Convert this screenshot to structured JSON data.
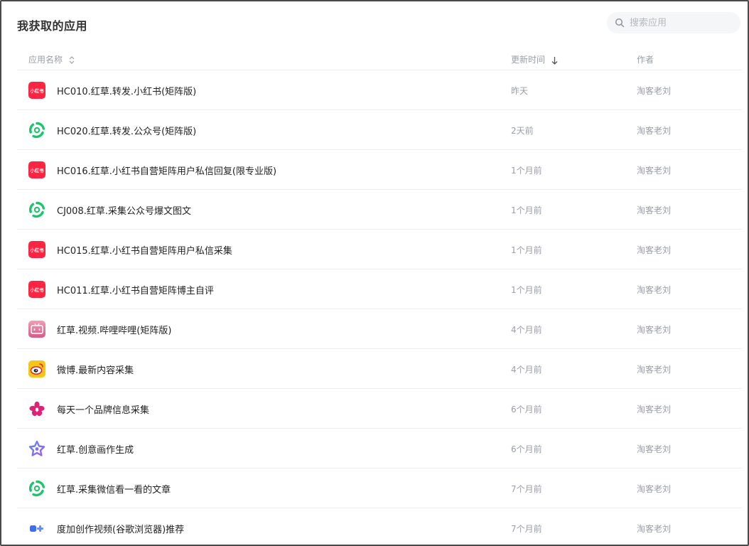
{
  "page": {
    "title": "我获取的应用"
  },
  "search": {
    "placeholder": "搜索应用",
    "value": ""
  },
  "table": {
    "columns": {
      "name": "应用名称",
      "updated": "更新时间",
      "author": "作者"
    },
    "rows": [
      {
        "icon": "xiaohongshu-icon",
        "name": "HC010.红草.转发.小红书(矩阵版)",
        "updated": "昨天",
        "author": "淘客老刘"
      },
      {
        "icon": "wechat-official-account-icon",
        "name": "HC020.红草.转发.公众号(矩阵版)",
        "updated": "2天前",
        "author": "淘客老刘"
      },
      {
        "icon": "xiaohongshu-icon",
        "name": "HC016.红草.小红书自营矩阵用户私信回复(限专业版)",
        "updated": "1个月前",
        "author": "淘客老刘"
      },
      {
        "icon": "wechat-official-account-icon",
        "name": "CJ008.红草.采集公众号爆文图文",
        "updated": "1个月前",
        "author": "淘客老刘"
      },
      {
        "icon": "xiaohongshu-icon",
        "name": "HC015.红草.小红书自营矩阵用户私信采集",
        "updated": "1个月前",
        "author": "淘客老刘"
      },
      {
        "icon": "xiaohongshu-icon",
        "name": "HC011.红草.小红书自营矩阵博主自评",
        "updated": "1个月前",
        "author": "淘客老刘"
      },
      {
        "icon": "bilibili-icon",
        "name": "红草.视频.哔哩哔哩(矩阵版)",
        "updated": "4个月前",
        "author": "淘客老刘"
      },
      {
        "icon": "weibo-icon",
        "name": "微博.最新内容采集",
        "updated": "4个月前",
        "author": "淘客老刘"
      },
      {
        "icon": "flower-brand-icon",
        "name": "每天一个品牌信息采集",
        "updated": "6个月前",
        "author": "淘客老刘"
      },
      {
        "icon": "star-ai-icon",
        "name": "红草.创意画作生成",
        "updated": "6个月前",
        "author": "淘客老刘"
      },
      {
        "icon": "wechat-official-account-icon",
        "name": "红草.采集微信看一看的文章",
        "updated": "7个月前",
        "author": "淘客老刘"
      },
      {
        "icon": "duojia-creation-icon",
        "name": "度加创作视频(谷歌浏览器)推荐",
        "updated": "7个月前",
        "author": "淘客老刘"
      }
    ]
  },
  "icon_labels": {
    "xiaohongshu": "小红书"
  },
  "colors": {
    "xiaohongshu": "#ff2442",
    "wechat_green": "#1ec46b",
    "bilibili_pink": "#e6708f",
    "weibo_yellow": "#f5c518",
    "weibo_red": "#e6162d",
    "flower": "#e02277",
    "star_purple": "#7b6cf0",
    "duojia_blue": "#3d6cf5"
  }
}
